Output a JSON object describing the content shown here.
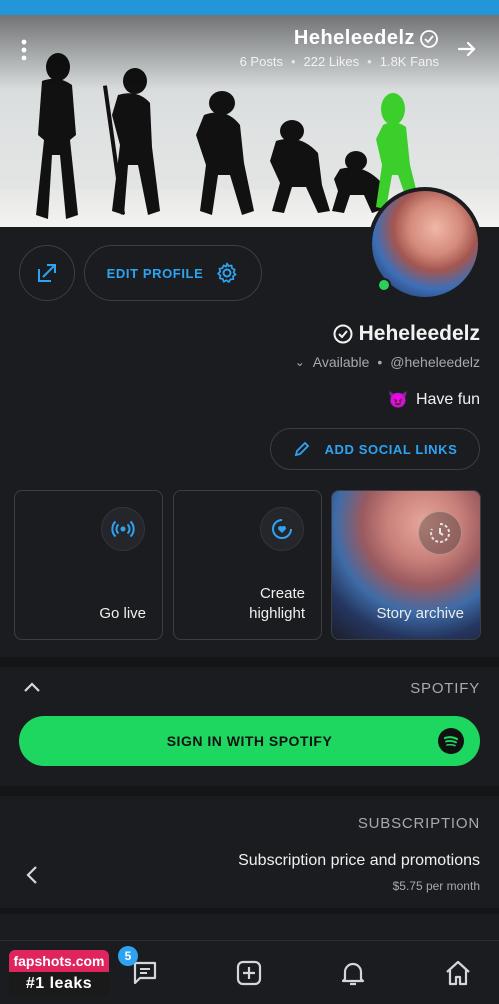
{
  "cover": {
    "name": "Heheleedelz",
    "stats": {
      "posts": "6 Posts",
      "likes": "222 Likes",
      "fans": "1.8K Fans"
    },
    "sep": "•"
  },
  "profile": {
    "edit_label": "EDIT PROFILE",
    "name": "Heheleedelz",
    "handle": "@heheleedelz",
    "status": "Available",
    "bio": "Have fun",
    "bio_emoji": "😈",
    "social_label": "ADD SOCIAL LINKS"
  },
  "tiles": {
    "live_label": "Go live",
    "highlight_label": "Create\nhighlight",
    "story_label": "Story archive"
  },
  "spotify": {
    "section_title": "SPOTIFY",
    "sign_in_label": "SIGN IN WITH SPOTIFY"
  },
  "subscription": {
    "section_title": "SUBSCRIPTION",
    "row_title": "Subscription price and promotions",
    "row_price": "$5.75 per month"
  },
  "nav": {
    "messages_badge": "5"
  },
  "watermark": {
    "site": "fapshots.com",
    "tagline": "#1 leaks"
  },
  "colors": {
    "accent": "#2ea3f2",
    "spotify_green": "#1ed760",
    "online": "#2bd05b",
    "background": "#1b1c1f"
  },
  "icons": {
    "back": "arrow-right-icon",
    "menu": "vertical-dots-icon",
    "verified": "verified-badge-icon",
    "gear": "gear-icon",
    "share": "share-icon",
    "pencil": "pencil-icon",
    "live": "broadcast-icon",
    "highlight": "heart-circle-icon",
    "archive": "history-icon",
    "home": "home-icon",
    "bell": "bell-icon",
    "add": "add-square-icon",
    "messages": "messages-icon",
    "spotify": "spotify-icon"
  }
}
